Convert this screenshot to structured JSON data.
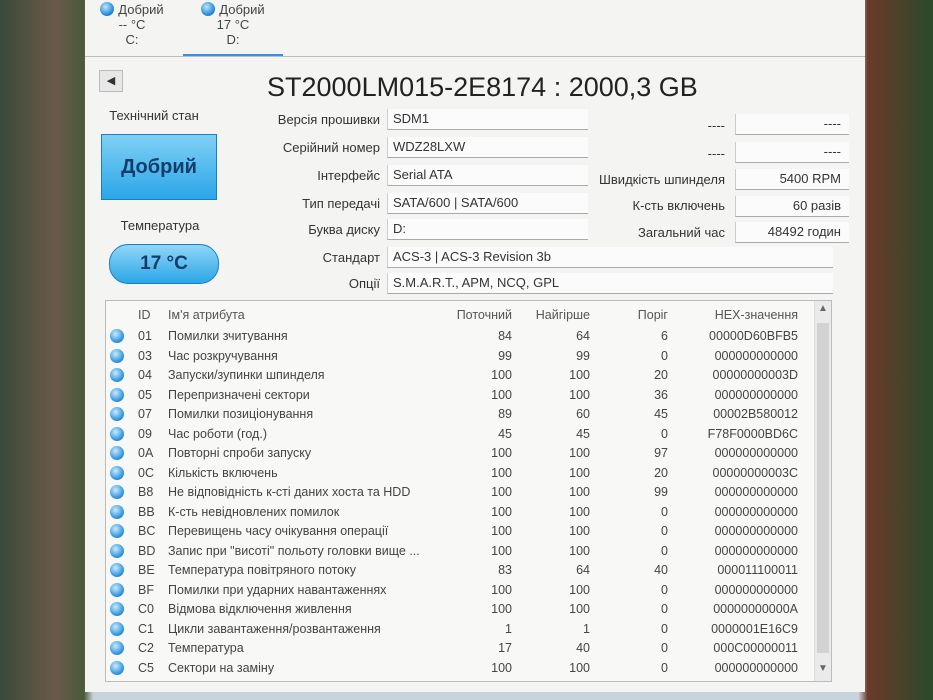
{
  "drives": [
    {
      "status": "Добрий",
      "temp": "-- °C",
      "letter": "C:"
    },
    {
      "status": "Добрий",
      "temp": "17 °C",
      "letter": "D:"
    }
  ],
  "title": "ST2000LM015-2E8174 : 2000,3 GB",
  "health": {
    "label": "Технічний стан",
    "value": "Добрий"
  },
  "temperature": {
    "label": "Температура",
    "value": "17 °C"
  },
  "fields": [
    {
      "label": "Версія прошивки",
      "value": "SDM1"
    },
    {
      "label": "Серійний номер",
      "value": "WDZ28LXW"
    },
    {
      "label": "Інтерфейс",
      "value": "Serial ATA"
    },
    {
      "label": "Тип передачі",
      "value": "SATA/600 | SATA/600"
    },
    {
      "label": "Буква диску",
      "value": "D:"
    },
    {
      "label": "Стандарт",
      "value": "ACS-3 | ACS-3 Revision 3b"
    },
    {
      "label": "Опції",
      "value": "S.M.A.R.T., APM, NCQ, GPL"
    }
  ],
  "right_fields": [
    {
      "label": "----",
      "value": "----"
    },
    {
      "label": "----",
      "value": "----"
    },
    {
      "label": "Швидкість шпинделя",
      "value": "5400 RPM"
    },
    {
      "label": "К-сть включень",
      "value": "60 разів"
    },
    {
      "label": "Загальний час",
      "value": "48492 годин"
    }
  ],
  "table": {
    "headers": {
      "id": "ID",
      "name": "Ім'я атрибута",
      "current": "Поточний",
      "worst": "Найгірше",
      "threshold": "Поріг",
      "hex": "HEX-значення"
    },
    "rows": [
      [
        "01",
        "Помилки зчитування",
        "84",
        "64",
        "6",
        "00000D60BFB5"
      ],
      [
        "03",
        "Час розкручування",
        "99",
        "99",
        "0",
        "000000000000"
      ],
      [
        "04",
        "Запуски/зупинки шпинделя",
        "100",
        "100",
        "20",
        "00000000003D"
      ],
      [
        "05",
        "Перепризначені сектори",
        "100",
        "100",
        "36",
        "000000000000"
      ],
      [
        "07",
        "Помилки позиціонування",
        "89",
        "60",
        "45",
        "00002B580012"
      ],
      [
        "09",
        "Час роботи (год.)",
        "45",
        "45",
        "0",
        "F78F0000BD6C"
      ],
      [
        "0A",
        "Повторні спроби запуску",
        "100",
        "100",
        "97",
        "000000000000"
      ],
      [
        "0C",
        "Кількість включень",
        "100",
        "100",
        "20",
        "00000000003C"
      ],
      [
        "B8",
        "Не відповідність к-сті даних хоста та HDD",
        "100",
        "100",
        "99",
        "000000000000"
      ],
      [
        "BB",
        "К-сть невідновлених помилок",
        "100",
        "100",
        "0",
        "000000000000"
      ],
      [
        "BC",
        "Перевищень часу очікування операції",
        "100",
        "100",
        "0",
        "000000000000"
      ],
      [
        "BD",
        "Запис при \"висоті\" польоту головки вище ...",
        "100",
        "100",
        "0",
        "000000000000"
      ],
      [
        "BE",
        "Температура повітряного потоку",
        "83",
        "64",
        "40",
        "000011100011"
      ],
      [
        "BF",
        "Помилки при ударних навантаженнях",
        "100",
        "100",
        "0",
        "000000000000"
      ],
      [
        "C0",
        "Відмова відключення живлення",
        "100",
        "100",
        "0",
        "00000000000A"
      ],
      [
        "C1",
        "Цикли завантаження/розвантаження",
        "1",
        "1",
        "0",
        "0000001E16C9"
      ],
      [
        "C2",
        "Температура",
        "17",
        "40",
        "0",
        "000C00000011"
      ],
      [
        "C5",
        "Сектори на заміну",
        "100",
        "100",
        "0",
        "000000000000"
      ]
    ]
  }
}
